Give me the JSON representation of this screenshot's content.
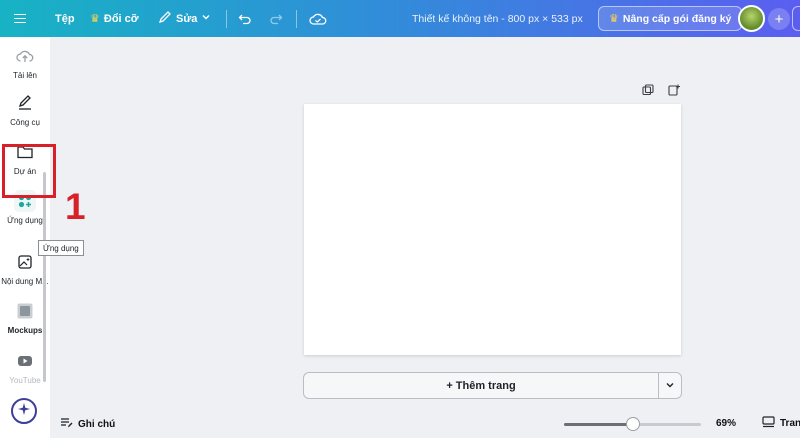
{
  "header": {
    "file_label": "Tệp",
    "resize_label": "Đổi cỡ",
    "edit_label": "Sửa",
    "doc_title": "Thiết kế không tên - 800 px × 533 px",
    "upgrade_label": "Nâng cấp gói đăng ký",
    "icons": [
      "menu-icon",
      "crown-icon",
      "pencil-icon",
      "chevron-down-icon",
      "undo-icon",
      "redo-icon",
      "cloud-check-icon",
      "plus-icon"
    ]
  },
  "sidebar": {
    "items": [
      {
        "label": "Tải lên",
        "icon": "cloud-upload-icon"
      },
      {
        "label": "Công cụ",
        "icon": "draw-icon"
      },
      {
        "label": "Dự án",
        "icon": "folder-icon"
      },
      {
        "label": "Ứng dụng",
        "icon": "apps-icon"
      },
      {
        "label": "Nội dung M...",
        "icon": "magic-media-icon"
      },
      {
        "label": "Mockups",
        "icon": "mockups-icon"
      },
      {
        "label": "YouTube",
        "icon": "youtube-icon"
      }
    ],
    "tooltip": "Ứng dụng",
    "annotation_number": "1"
  },
  "canvas": {
    "add_page_label": "+ Thêm trang"
  },
  "footer": {
    "notes_label": "Ghi chú",
    "zoom_label": "69%",
    "zoom_fraction": 0.5,
    "pages_label": "Trang"
  },
  "colors": {
    "accent_red": "#d8202a",
    "topbar_start": "#17b3c4",
    "topbar_end": "#5b5ef0",
    "apps_teal": "#1ea89c"
  }
}
